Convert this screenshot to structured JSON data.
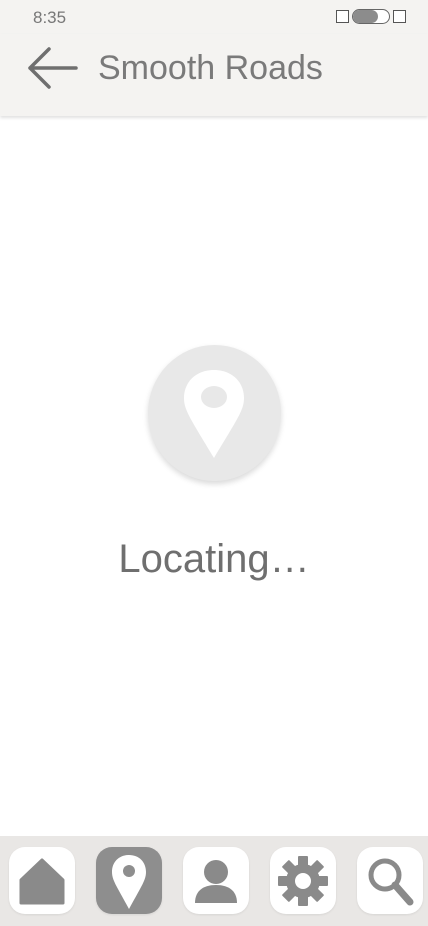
{
  "status_bar": {
    "time": "8:35"
  },
  "app_bar": {
    "title": "Smooth Roads",
    "back_icon": "arrow-left-icon"
  },
  "main": {
    "pin_icon": "map-pin-icon",
    "status_text": "Locating…"
  },
  "bottom_nav": {
    "items": [
      {
        "icon": "home-icon",
        "active": false
      },
      {
        "icon": "map-pin-icon",
        "active": true
      },
      {
        "icon": "user-icon",
        "active": false
      },
      {
        "icon": "gear-icon",
        "active": false
      },
      {
        "icon": "search-icon",
        "active": false
      }
    ]
  },
  "colors": {
    "bar_background": "#f4f3f1",
    "nav_background": "#e9e7e5",
    "active_button": "#8e8e8e",
    "icon_gray": "#8a8a8a"
  }
}
